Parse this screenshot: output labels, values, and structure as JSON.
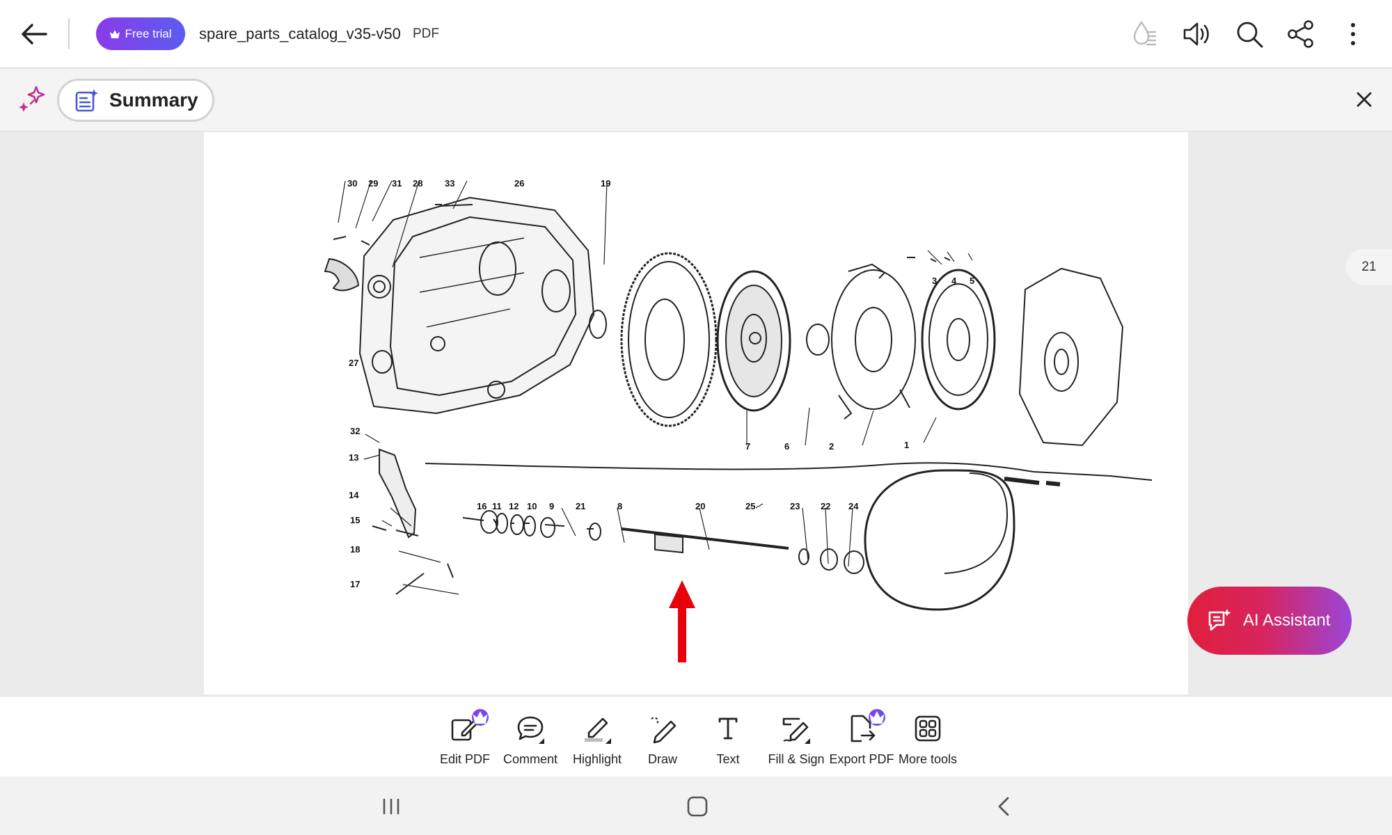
{
  "header": {
    "back_icon": "arrow-left-icon",
    "trial_label": "Free trial",
    "document_name": "spare_parts_catalog_v35-v50",
    "document_type": "PDF",
    "icons": [
      "liquid-mode-icon",
      "read-aloud-icon",
      "search-icon",
      "share-icon",
      "more-vertical-icon"
    ]
  },
  "summary_bar": {
    "label": "Summary",
    "close_icon": "close-icon"
  },
  "page_indicator": "21",
  "diagram": {
    "callouts": [
      "30",
      "29",
      "31",
      "28",
      "33",
      "26",
      "19",
      "3",
      "4",
      "5",
      "27",
      "7",
      "6",
      "2",
      "1",
      "32",
      "13",
      "14",
      "15",
      "16",
      "11",
      "12",
      "10",
      "9",
      "21",
      "8",
      "20",
      "25",
      "23",
      "22",
      "24",
      "18",
      "17"
    ]
  },
  "ai_assistant": {
    "label": "AI Assistant"
  },
  "toolbar": {
    "tools": [
      {
        "label": "Edit PDF",
        "premium": true
      },
      {
        "label": "Comment",
        "premium": false
      },
      {
        "label": "Highlight",
        "premium": false
      },
      {
        "label": "Draw",
        "premium": false
      },
      {
        "label": "Text",
        "premium": false
      },
      {
        "label": "Fill & Sign",
        "premium": false
      },
      {
        "label": "Export PDF",
        "premium": true
      },
      {
        "label": "More tools",
        "premium": false
      }
    ]
  },
  "colors": {
    "accent_purple": "#6f4be8",
    "ai_gradient_start": "#e01f3d",
    "ai_gradient_end": "#9a46d8",
    "pointer_arrow": "#e8000b"
  }
}
